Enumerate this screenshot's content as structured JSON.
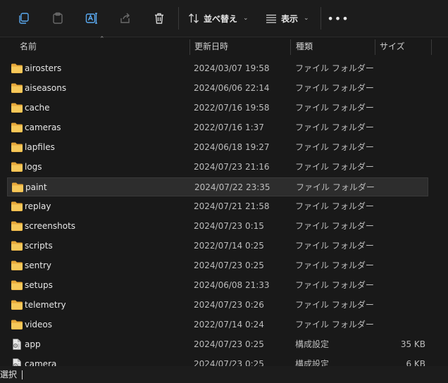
{
  "toolbar": {
    "sort_label": "並べ替え",
    "view_label": "表示"
  },
  "columns": {
    "name": "名前",
    "date": "更新日時",
    "type": "種類",
    "size": "サイズ"
  },
  "rows": [
    {
      "name": "airosters",
      "date": "2024/03/07 19:58",
      "type": "ファイル フォルダー",
      "size": "",
      "icon": "folder-icon"
    },
    {
      "name": "aiseasons",
      "date": "2024/06/06 22:14",
      "type": "ファイル フォルダー",
      "size": "",
      "icon": "folder-icon"
    },
    {
      "name": "cache",
      "date": "2022/07/16 19:58",
      "type": "ファイル フォルダー",
      "size": "",
      "icon": "folder-icon"
    },
    {
      "name": "cameras",
      "date": "2022/07/16 1:37",
      "type": "ファイル フォルダー",
      "size": "",
      "icon": "folder-icon"
    },
    {
      "name": "lapfiles",
      "date": "2024/06/18 19:27",
      "type": "ファイル フォルダー",
      "size": "",
      "icon": "folder-icon"
    },
    {
      "name": "logs",
      "date": "2024/07/23 21:16",
      "type": "ファイル フォルダー",
      "size": "",
      "icon": "folder-icon"
    },
    {
      "name": "paint",
      "date": "2024/07/22 23:35",
      "type": "ファイル フォルダー",
      "size": "",
      "icon": "folder-icon",
      "selected": true
    },
    {
      "name": "replay",
      "date": "2024/07/21 21:58",
      "type": "ファイル フォルダー",
      "size": "",
      "icon": "folder-icon"
    },
    {
      "name": "screenshots",
      "date": "2024/07/23 0:15",
      "type": "ファイル フォルダー",
      "size": "",
      "icon": "folder-icon"
    },
    {
      "name": "scripts",
      "date": "2022/07/14 0:25",
      "type": "ファイル フォルダー",
      "size": "",
      "icon": "folder-icon"
    },
    {
      "name": "sentry",
      "date": "2024/07/23 0:25",
      "type": "ファイル フォルダー",
      "size": "",
      "icon": "folder-icon"
    },
    {
      "name": "setups",
      "date": "2024/06/08 21:33",
      "type": "ファイル フォルダー",
      "size": "",
      "icon": "folder-icon"
    },
    {
      "name": "telemetry",
      "date": "2024/07/23 0:26",
      "type": "ファイル フォルダー",
      "size": "",
      "icon": "folder-icon"
    },
    {
      "name": "videos",
      "date": "2022/07/14 0:24",
      "type": "ファイル フォルダー",
      "size": "",
      "icon": "folder-icon"
    },
    {
      "name": "app",
      "date": "2024/07/23 0:25",
      "type": "構成設定",
      "size": "35 KB",
      "icon": "settings-file-icon"
    },
    {
      "name": "camera",
      "date": "2024/07/23 0:25",
      "type": "構成設定",
      "size": "6 KB",
      "icon": "settings-file-icon"
    }
  ],
  "status": {
    "text": "選択"
  },
  "colors": {
    "background": "#191919",
    "folder": "#f2c14e",
    "selected_row": "#2d2d2d"
  }
}
